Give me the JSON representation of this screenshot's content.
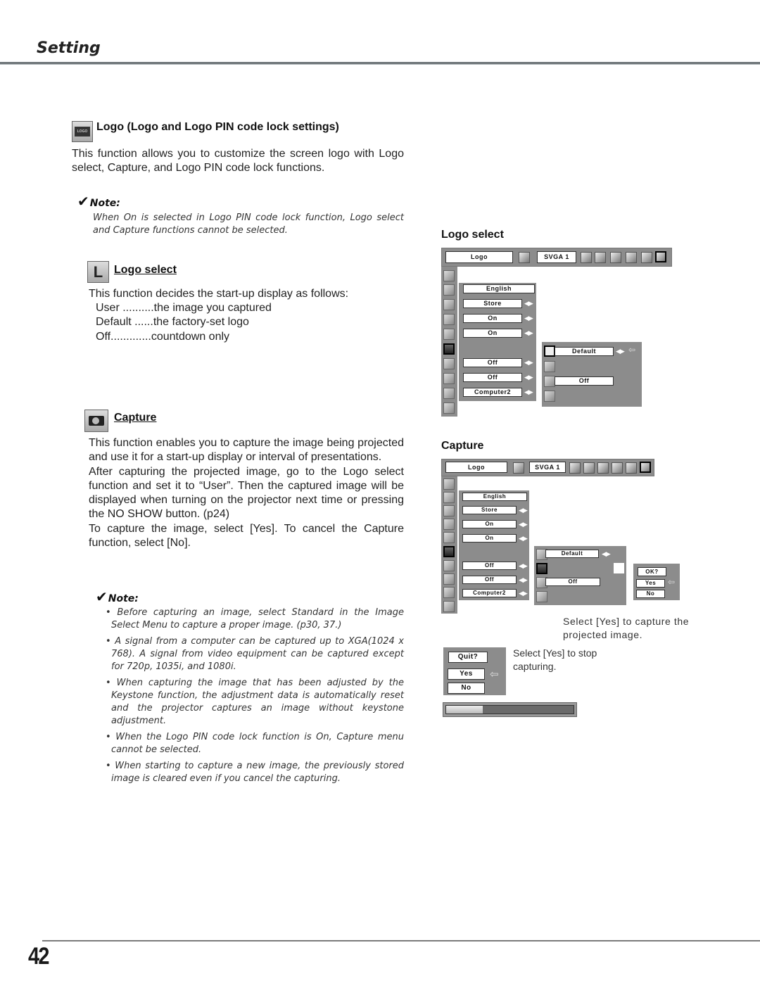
{
  "header": {
    "section_title": "Setting"
  },
  "logo_section": {
    "icon": "logo-icon",
    "title": "Logo (Logo and Logo PIN code lock settings)",
    "intro": "This function allows you to customize the screen logo with Logo select, Capture, and Logo PIN code lock functions.",
    "note_label": "Note:",
    "note_text": "When On is selected in Logo PIN code lock function, Logo select and Capture functions cannot be selected."
  },
  "logo_select": {
    "icon": "logo-select-icon",
    "title": "Logo select",
    "intro": "This function decides the start-up display as follows:",
    "options": [
      "User ..........the image you captured",
      "Default ......the factory-set logo",
      "Off.............countdown only"
    ]
  },
  "capture": {
    "icon": "camera-icon",
    "title": "Capture",
    "para1": "This function enables you to capture the image being projected and use it for a start-up display or interval of presentations.",
    "para2": "After capturing the projected image, go to the Logo select function and set it to “User”.  Then the captured image will be displayed when turning on the projector next time or pressing the NO SHOW button.  (p24)",
    "para3": "To capture the image, select [Yes].  To cancel the Capture function, select [No].",
    "note_label": "Note:",
    "notes": [
      "• Before capturing an image, select Standard in the Image Select Menu to capture a proper image.  (p30, 37.)",
      "• A signal from a computer can be captured up to XGA(1024 x 768).  A signal from video equipment can be captured except for 720p, 1035i, and 1080i.",
      "• When capturing the image that has been adjusted by the Keystone function, the adjustment data is automatically reset and the projector captures an image without keystone adjustment.",
      "• When the Logo PIN code lock function is On, Capture menu cannot be selected.",
      "• When starting to capture a new image, the previously stored image is cleared even if you cancel the capturing."
    ]
  },
  "logo_select_menu": {
    "heading": "Logo select",
    "toolbar": {
      "title": "Logo",
      "source": "SVGA 1"
    },
    "main_fields": [
      "English",
      "Store",
      "On",
      "On",
      "",
      "Off",
      "Off",
      "Computer2"
    ],
    "sub_fields": {
      "logo_select": "Default",
      "pin_lock": "Off"
    }
  },
  "capture_menu": {
    "heading": "Capture",
    "toolbar": {
      "title": "Logo",
      "source": "SVGA 1"
    },
    "main_fields": [
      "English",
      "Store",
      "On",
      "On",
      "",
      "Off",
      "Off",
      "Computer2"
    ],
    "sub_fields": {
      "logo_select": "Default",
      "pin_lock": "Off"
    },
    "confirm": {
      "question": "OK?",
      "yes": "Yes",
      "no": "No"
    },
    "caption_confirm": "Select [Yes] to capture the projected image.",
    "quit": {
      "question": "Quit?",
      "yes": "Yes",
      "no": "No"
    },
    "caption_quit": "Select [Yes] to stop capturing.",
    "progress_percent": 29
  },
  "footer": {
    "page_number": "42"
  }
}
